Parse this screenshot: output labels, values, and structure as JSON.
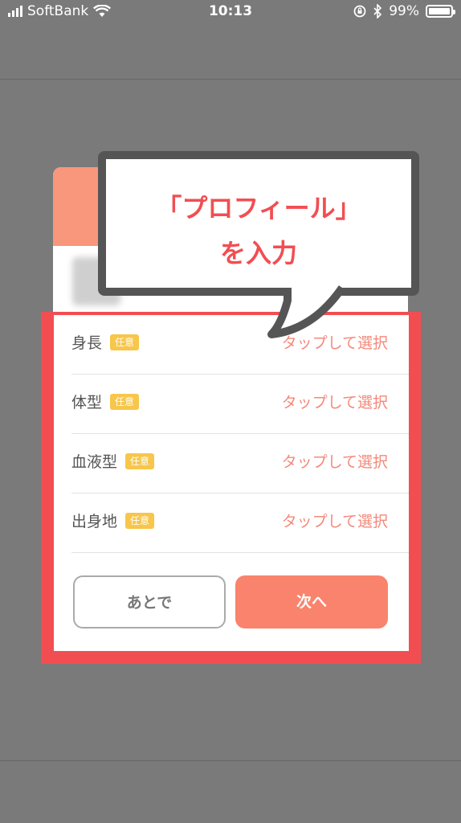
{
  "status_bar": {
    "carrier": "SoftBank",
    "time": "10:13",
    "battery": "99%",
    "battery_level": 0.99
  },
  "callout": {
    "line1": "「プロフィール」",
    "line2": "を入力"
  },
  "profile_form": {
    "rows": [
      {
        "label": "身長",
        "badge": "任意",
        "value": "タップして選択"
      },
      {
        "label": "体型",
        "badge": "任意",
        "value": "タップして選択"
      },
      {
        "label": "血液型",
        "badge": "任意",
        "value": "タップして選択"
      },
      {
        "label": "出身地",
        "badge": "任意",
        "value": "タップして選択"
      }
    ],
    "later_button": "あとで",
    "next_button": "次へ"
  },
  "colors": {
    "accent": "#f9836c",
    "highlight": "#f24e52",
    "badge": "#f7c64a"
  }
}
